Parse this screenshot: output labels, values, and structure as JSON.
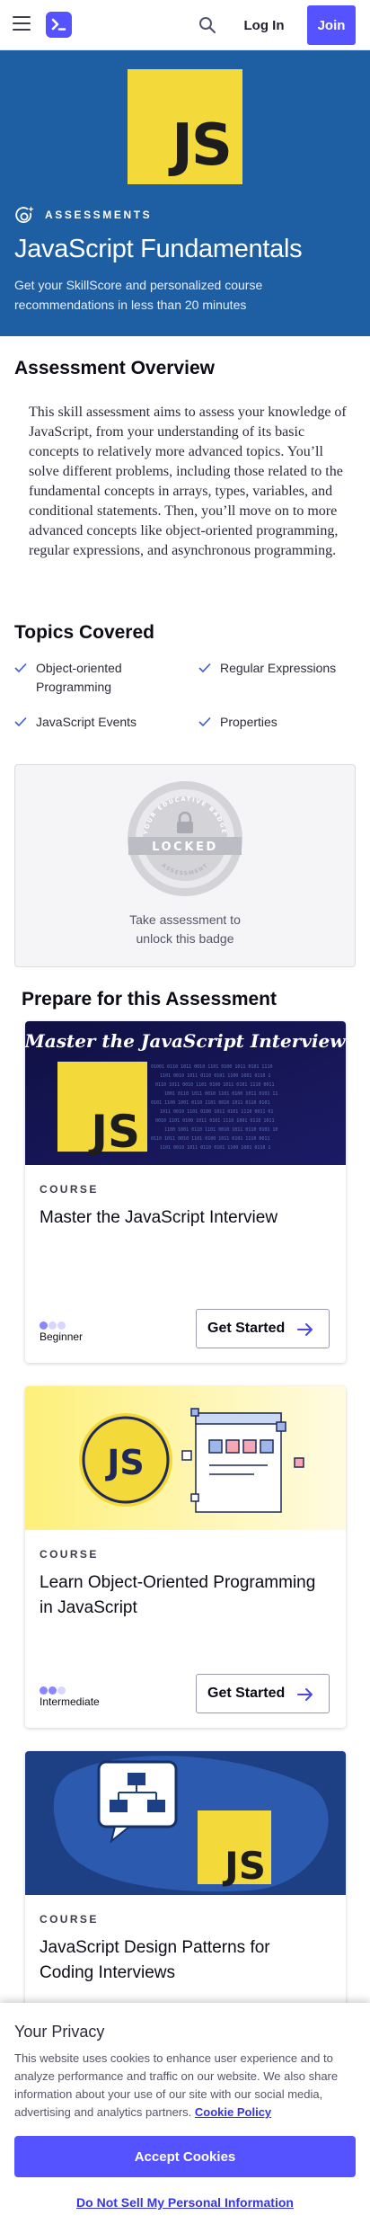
{
  "header": {
    "login_label": "Log In",
    "join_label": "Join"
  },
  "hero": {
    "badge_text": "JS",
    "eyebrow": "ASSESSMENTS",
    "title": "JavaScript Fundamentals",
    "subtitle": "Get your SkillScore and personalized course recommendations in less than 20 minutes"
  },
  "overview": {
    "heading": "Assessment Overview",
    "body": "This skill assessment aims to assess your knowledge of JavaScript, from your understanding of its basic concepts to relatively more advanced topics. You’ll solve different problems, including those related to the fundamental concepts in arrays, types, variables, and conditional statements. Then, you’ll move on to more advanced concepts like object-oriented programming, regular expressions, and asynchronous programming."
  },
  "topics": {
    "heading": "Topics Covered",
    "items": [
      "Object-oriented Programming",
      "Regular Expressions",
      "JavaScript Events",
      "Properties"
    ]
  },
  "badge_card": {
    "ring_text_top": "YOUR EDUCATIVE BADGE",
    "ring_text_bottom": "ASSESSMENT",
    "status": "LOCKED",
    "message": "Take assessment to unlock this badge"
  },
  "prepare": {
    "heading": "Prepare for this Assessment",
    "courses": [
      {
        "image_title": "Master the JavaScript Interview",
        "image_badge": "JS",
        "label": "COURSE",
        "title": "Master the JavaScript Interview",
        "level": "Beginner",
        "level_fraction": 0.333,
        "cta": "Get Started"
      },
      {
        "image_badge": "JS",
        "label": "COURSE",
        "title": "Learn Object-Oriented Programming in JavaScript",
        "level": "Intermediate",
        "level_fraction": 0.667,
        "cta": "Get Started"
      },
      {
        "image_badge": "JS",
        "label": "COURSE",
        "title": "JavaScript Design Patterns for Coding Interviews"
      }
    ]
  },
  "cookie": {
    "title": "Your Privacy",
    "text": "This website uses cookies to enhance user experience and to analyze performance and traffic on our website. We also share information about your use of our site with our social media, advertising and analytics partners.",
    "policy_link": "Cookie Policy",
    "accept_label": "Accept Cookies",
    "dnsmpi_label": "Do Not Sell My Personal Information"
  },
  "colors": {
    "brand": "#5553ff",
    "hero_bg": "#1e5ea3",
    "js_yellow": "#f4d93a",
    "link": "#3634e8"
  },
  "icons": {
    "menu": "hamburger-menu-icon",
    "logo": "educative-logo-icon",
    "search": "search-icon",
    "assessment": "assessment-icon",
    "check": "check-icon",
    "lock": "lock-icon",
    "arrow": "arrow-right-icon"
  }
}
